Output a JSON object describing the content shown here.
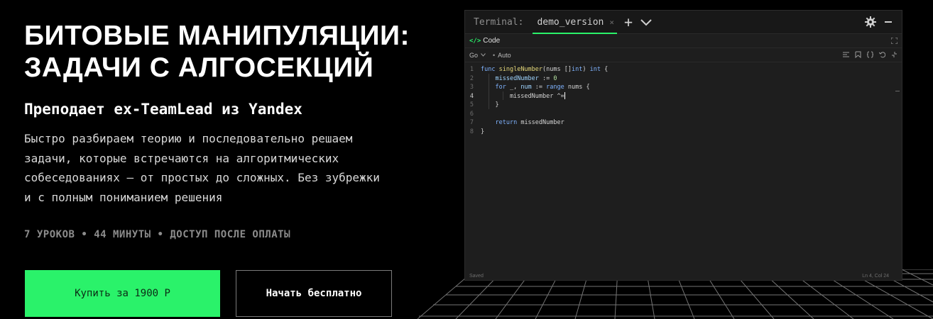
{
  "hero": {
    "title_line1": "БИТОВЫЕ МАНИПУЛЯЦИИ:",
    "title_line2": "ЗАДАЧИ С АЛГОСЕКЦИЙ",
    "subtitle": "Преподает ex-TeamLead из Yandex",
    "description": "Быстро разбираем теорию и последовательно решаем задачи, которые встречаются на алгоритмических собеседованиях — от простых до сложных. Без зубрежки и с полным пониманием решения",
    "meta": "7 УРОКОВ • 44 МИНУТЫ • ДОСТУП ПОСЛЕ ОПЛАТЫ",
    "buy_label": "Купить за 1900 Р",
    "free_label": "Начать бесплатно"
  },
  "colors": {
    "accent": "#2af26a",
    "background": "#000000",
    "terminal_bg": "#1e1e1e"
  },
  "terminal": {
    "label": "Terminal:",
    "tab": "demo_version",
    "panel_title": "Code",
    "language": "Go",
    "format_mode": "Auto",
    "status_saved": "Saved",
    "status_position": "Ln 4, Col 24",
    "code_lines": [
      {
        "n": "1",
        "text": "func singleNumber(nums []int) int {"
      },
      {
        "n": "2",
        "text": "missedNumber := 0"
      },
      {
        "n": "3",
        "text": "for _, num := range nums {"
      },
      {
        "n": "4",
        "text": "missedNumber ^="
      },
      {
        "n": "5",
        "text": "}"
      },
      {
        "n": "6",
        "text": ""
      },
      {
        "n": "7",
        "text": "return missedNumber"
      },
      {
        "n": "8",
        "text": "}"
      }
    ]
  }
}
